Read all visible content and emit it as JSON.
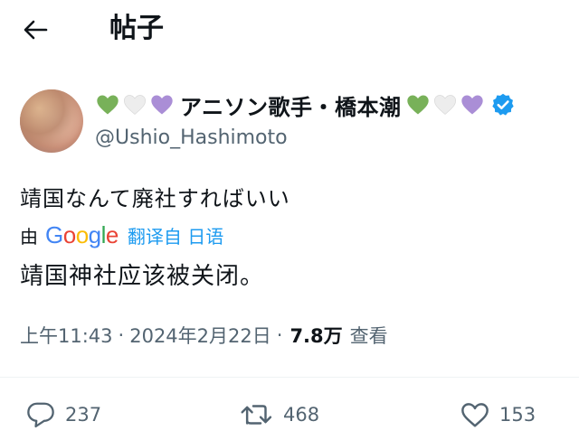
{
  "header": {
    "title": "帖子"
  },
  "author": {
    "display_name": "アニソン歌手・橋本潮",
    "handle": "@Ushio_Hashimoto",
    "verified": true,
    "name_hearts_left": [
      "green-heart",
      "white-heart",
      "purple-heart"
    ],
    "name_hearts_right": [
      "green-heart",
      "white-heart",
      "purple-heart"
    ]
  },
  "post": {
    "text": "靖国なんて廃社すればいい",
    "translation": {
      "by_label": "由",
      "provider": "Google",
      "link_label": "翻译自 日语",
      "text": "靖国神社应该被关闭。"
    },
    "time": "上午11:43",
    "date": "2024年2月22日",
    "separator": "·",
    "views_count": "7.8万",
    "views_label": "查看"
  },
  "actions": {
    "reply_count": "237",
    "repost_count": "468",
    "like_count": "153"
  },
  "colors": {
    "link": "#1d9bf0",
    "muted": "#536471",
    "text": "#0f1419",
    "heart_green": "#78b159",
    "heart_purple": "#aa8ed6",
    "heart_white": "#e8e8e8"
  }
}
